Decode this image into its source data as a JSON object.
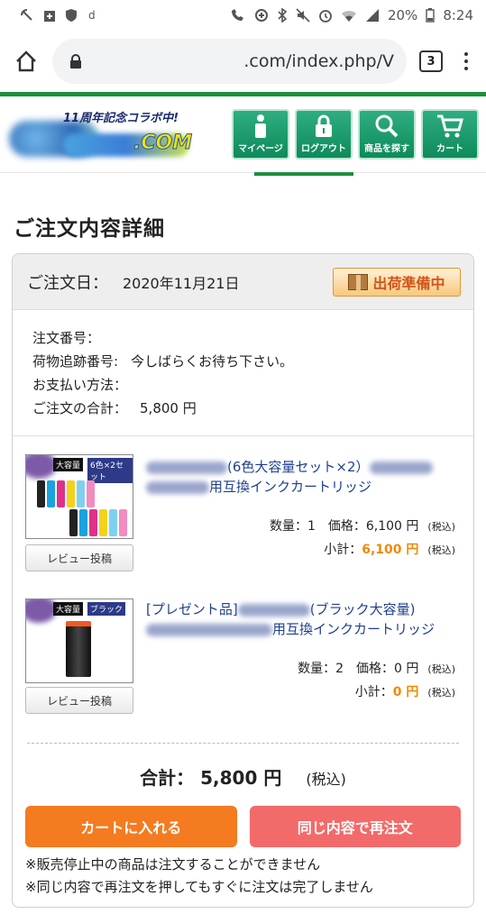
{
  "status_bar": {
    "battery": "20%",
    "time": "8:24"
  },
  "browser": {
    "url": ".com/index.php/V",
    "tab_count": "3"
  },
  "site": {
    "logo_badge": "11周年記念コラボ中!",
    "logo_suffix": ".COM",
    "nav": [
      {
        "label": "マイページ",
        "icon": "user-icon"
      },
      {
        "label": "ログアウト",
        "icon": "lock-icon"
      },
      {
        "label": "商品を探す",
        "icon": "search-icon"
      },
      {
        "label": "カート",
        "icon": "cart-icon"
      }
    ]
  },
  "page": {
    "title": "ご注文内容詳細"
  },
  "order": {
    "date_label": "ご注文日：",
    "date": "2020年11月21日",
    "status": "出荷準備中",
    "info": [
      {
        "label": "注文番号：",
        "value": ""
      },
      {
        "label": "荷物追跡番号:",
        "value": "今しばらくお待ち下さい。"
      },
      {
        "label": "お支払い方法：",
        "value": ""
      },
      {
        "label": "ご注文の合計：",
        "value": "5,800 円"
      }
    ]
  },
  "items": [
    {
      "thumb_tag": "大容量",
      "thumb_tag2": "6色×2セット",
      "title_a": "(6色大容量セット×2）",
      "title_b": "用互換インクカートリッジ",
      "qty_price": "数量：1　価格：6,100 円",
      "tax": "(税込)",
      "subtotal_label": "小計：",
      "subtotal": "6,100 円",
      "review": "レビュー投稿"
    },
    {
      "thumb_tag": "大容量",
      "thumb_tag2": "ブラック",
      "title_a": "[プレゼント品]",
      "title_a2": "(ブラック大容量)",
      "title_b": "用互換インクカートリッジ",
      "qty_price": "数量：2　価格：0 円",
      "tax": "(税込)",
      "subtotal_label": "小計：",
      "subtotal": "0 円",
      "review": "レビュー投稿"
    }
  ],
  "summary": {
    "total_label": "合計：",
    "total": "5,800 円",
    "tax": "(税込)"
  },
  "buttons": {
    "add_cart": "カートに入れる",
    "reorder": "同じ内容で再注文"
  },
  "notes": [
    "※販売停止中の商品は注文することができません",
    "※同じ内容で再注文を押してもすぐに注文は完了しません"
  ],
  "colors": {
    "brand_green": "#1d8f3c",
    "nav_green": "#14956a",
    "orange": "#f47b20",
    "coral": "#f36a6a"
  }
}
